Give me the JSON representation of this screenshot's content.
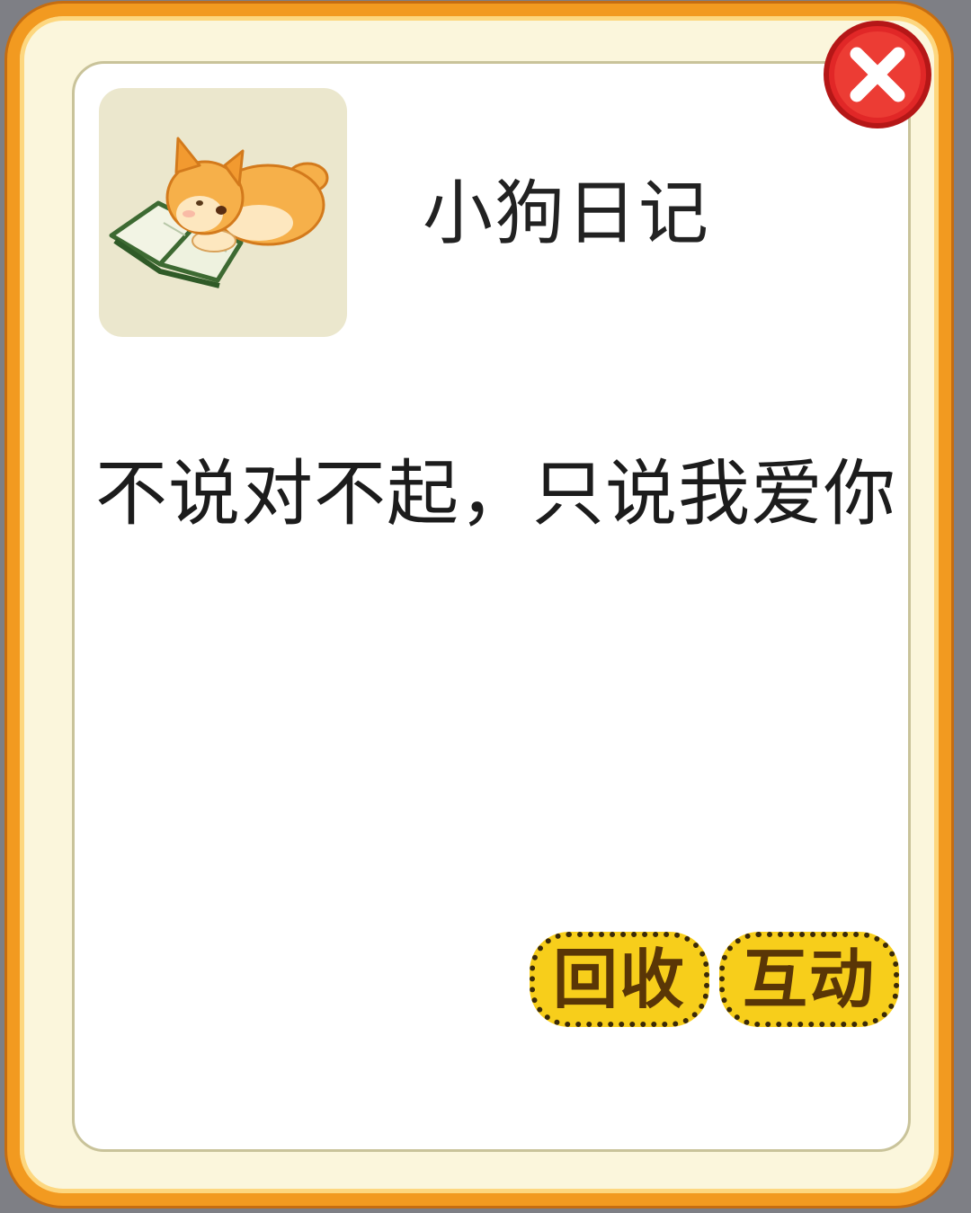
{
  "dialog": {
    "title": "小狗日记",
    "message": "不说对不起，只说我爱你",
    "item_icon": "puppy-reading-book-icon",
    "close_icon": "close-x-icon"
  },
  "actions": {
    "recycle_label": "回收",
    "interact_label": "互动"
  },
  "colors": {
    "frame_orange": "#f29a20",
    "frame_cream": "#fbf6dc",
    "button_yellow": "#f7ce1b",
    "close_red": "#e12727"
  }
}
